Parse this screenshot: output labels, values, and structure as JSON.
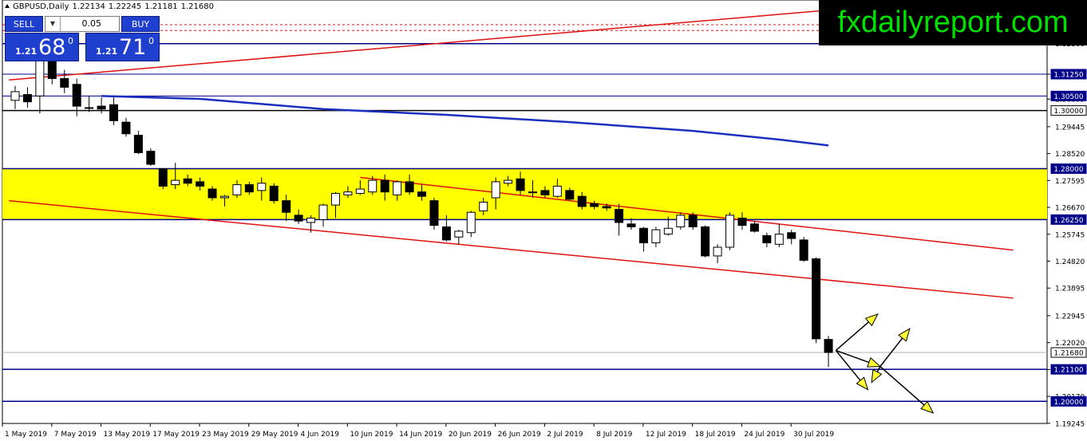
{
  "header": {
    "symbol": "GBPUSD,Daily",
    "open": "1.22134",
    "high": "1.22245",
    "low": "1.21181",
    "close": "1.21680"
  },
  "trade_panel": {
    "sell_label": "SELL",
    "buy_label": "BUY",
    "lot": "0.05",
    "sell_price": {
      "small": "1.21",
      "big": "68",
      "sup": "0"
    },
    "buy_price": {
      "small": "1.21",
      "big": "71",
      "sup": "0"
    }
  },
  "brand": "fxdailyreport.com",
  "colors": {
    "zone": "#ffff00",
    "trendline": "#e01010",
    "ma": "#1a2fbf",
    "level": "#00008b",
    "label_bg": "#00008b",
    "candle_bull": "#ffffff",
    "candle_bear": "#000000",
    "arrow_fill": "#ffff33",
    "brand_bg": "#000000",
    "brand_text": "#00e000"
  },
  "chart_data": {
    "type": "candlestick",
    "ylim": [
      1.1924,
      1.338
    ],
    "price_ticks": [
      "1.32300",
      "1.31250",
      "1.30395",
      "1.29445",
      "1.28520",
      "1.27595",
      "1.26670",
      "1.25745",
      "1.24820",
      "1.23895",
      "1.22945",
      "1.22020",
      "1.21095",
      "1.20170",
      "1.19245"
    ],
    "x_labels": [
      {
        "text": "1 May 2019",
        "i": 0
      },
      {
        "text": "7 May 2019",
        "i": 4
      },
      {
        "text": "13 May 2019",
        "i": 8
      },
      {
        "text": "17 May 2019",
        "i": 12
      },
      {
        "text": "23 May 2019",
        "i": 16
      },
      {
        "text": "29 May 2019",
        "i": 20
      },
      {
        "text": "4 Jun 2019",
        "i": 24
      },
      {
        "text": "10 Jun 2019",
        "i": 28
      },
      {
        "text": "14 Jun 2019",
        "i": 32
      },
      {
        "text": "20 Jun 2019",
        "i": 36
      },
      {
        "text": "26 Jun 2019",
        "i": 40
      },
      {
        "text": "2 Jul 2019",
        "i": 44
      },
      {
        "text": "8 Jul 2019",
        "i": 48
      },
      {
        "text": "12 Jul 2019",
        "i": 52
      },
      {
        "text": "18 Jul 2019",
        "i": 56
      },
      {
        "text": "24 Jul 2019",
        "i": 60
      },
      {
        "text": "30 Jul 2019",
        "i": 64
      }
    ],
    "candles": [
      [
        1.3035,
        1.3085,
        1.3005,
        1.3065
      ],
      [
        1.3055,
        1.308,
        1.301,
        1.303
      ],
      [
        1.305,
        1.319,
        1.299,
        1.318
      ],
      [
        1.3175,
        1.319,
        1.309,
        1.311
      ],
      [
        1.311,
        1.314,
        1.306,
        1.308
      ],
      [
        1.309,
        1.311,
        1.298,
        1.3015
      ],
      [
        1.301,
        1.305,
        1.2995,
        1.301
      ],
      [
        1.3015,
        1.3045,
        1.299,
        1.3005
      ],
      [
        1.302,
        1.3045,
        1.295,
        1.2965
      ],
      [
        1.296,
        1.2975,
        1.291,
        1.292
      ],
      [
        1.2915,
        1.293,
        1.285,
        1.2855
      ],
      [
        1.286,
        1.287,
        1.281,
        1.2815
      ],
      [
        1.28,
        1.28,
        1.273,
        1.274
      ],
      [
        1.2745,
        1.282,
        1.273,
        1.276
      ],
      [
        1.2765,
        1.278,
        1.274,
        1.275
      ],
      [
        1.2755,
        1.277,
        1.2725,
        1.274
      ],
      [
        1.273,
        1.274,
        1.269,
        1.27
      ],
      [
        1.27,
        1.271,
        1.267,
        1.2705
      ],
      [
        1.271,
        1.276,
        1.27,
        1.2745
      ],
      [
        1.2745,
        1.2755,
        1.271,
        1.272
      ],
      [
        1.2725,
        1.277,
        1.269,
        1.275
      ],
      [
        1.274,
        1.275,
        1.268,
        1.269
      ],
      [
        1.269,
        1.271,
        1.262,
        1.265
      ],
      [
        1.264,
        1.266,
        1.261,
        1.262
      ],
      [
        1.2615,
        1.264,
        1.258,
        1.263
      ],
      [
        1.2625,
        1.268,
        1.26,
        1.2675
      ],
      [
        1.2675,
        1.272,
        1.263,
        1.2715
      ],
      [
        1.271,
        1.274,
        1.27,
        1.272
      ],
      [
        1.2715,
        1.276,
        1.271,
        1.273
      ],
      [
        1.272,
        1.2775,
        1.271,
        1.276
      ],
      [
        1.276,
        1.278,
        1.269,
        1.272
      ],
      [
        1.271,
        1.276,
        1.269,
        1.2755
      ],
      [
        1.2755,
        1.278,
        1.271,
        1.272
      ],
      [
        1.272,
        1.2745,
        1.269,
        1.2705
      ],
      [
        1.269,
        1.27,
        1.259,
        1.2605
      ],
      [
        1.26,
        1.264,
        1.255,
        1.2555
      ],
      [
        1.2565,
        1.259,
        1.254,
        1.2585
      ],
      [
        1.258,
        1.2655,
        1.2565,
        1.265
      ],
      [
        1.2655,
        1.27,
        1.264,
        1.2685
      ],
      [
        1.27,
        1.277,
        1.266,
        1.2755
      ],
      [
        1.275,
        1.2775,
        1.274,
        1.276
      ],
      [
        1.2765,
        1.279,
        1.271,
        1.2725
      ],
      [
        1.272,
        1.276,
        1.27,
        1.272
      ],
      [
        1.2725,
        1.274,
        1.27,
        1.271
      ],
      [
        1.2705,
        1.2765,
        1.27,
        1.274
      ],
      [
        1.2725,
        1.2735,
        1.269,
        1.2695
      ],
      [
        1.2705,
        1.272,
        1.266,
        1.267
      ],
      [
        1.268,
        1.269,
        1.266,
        1.267
      ],
      [
        1.267,
        1.268,
        1.2655,
        1.2665
      ],
      [
        1.266,
        1.268,
        1.257,
        1.2615
      ],
      [
        1.261,
        1.263,
        1.259,
        1.26
      ],
      [
        1.2595,
        1.26,
        1.2515,
        1.2545
      ],
      [
        1.2545,
        1.26,
        1.253,
        1.259
      ],
      [
        1.2575,
        1.2635,
        1.257,
        1.2595
      ],
      [
        1.26,
        1.265,
        1.259,
        1.264
      ],
      [
        1.264,
        1.265,
        1.259,
        1.26
      ],
      [
        1.26,
        1.2605,
        1.2495,
        1.25
      ],
      [
        1.25,
        1.254,
        1.2475,
        1.253
      ],
      [
        1.253,
        1.265,
        1.252,
        1.264
      ],
      [
        1.263,
        1.265,
        1.259,
        1.2605
      ],
      [
        1.261,
        1.262,
        1.258,
        1.2585
      ],
      [
        1.257,
        1.258,
        1.253,
        1.2545
      ],
      [
        1.254,
        1.261,
        1.253,
        1.2575
      ],
      [
        1.258,
        1.259,
        1.254,
        1.256
      ],
      [
        1.2555,
        1.2565,
        1.248,
        1.2485
      ],
      [
        1.249,
        1.2495,
        1.22,
        1.2215
      ],
      [
        1.2213,
        1.2225,
        1.2118,
        1.2168
      ]
    ],
    "levels": [
      {
        "price": 1.323,
        "label": "",
        "color": "#00008b",
        "width": 1.5
      },
      {
        "price": 1.3125,
        "label": "1.31250",
        "color": "#00008b",
        "width": 1
      },
      {
        "price": 1.305,
        "label": "1.30500",
        "color": "#00008b",
        "width": 1
      },
      {
        "price": 1.3,
        "label": "1.30000",
        "color": "#000000",
        "width": 1.5
      },
      {
        "price": 1.28,
        "label": "1.28000",
        "color": "#00008b",
        "width": 1.5
      },
      {
        "price": 1.2625,
        "label": "1.26250",
        "color": "#00008b",
        "width": 1.5
      },
      {
        "price": 1.211,
        "label": "1.21100",
        "color": "#00008b",
        "width": 1.5
      },
      {
        "price": 1.2,
        "label": "1.20000",
        "color": "#00008b",
        "width": 1.5
      }
    ],
    "current_price": {
      "price": 1.2168,
      "label": "1.21680"
    },
    "zone": [
      1.2625,
      1.28
    ],
    "trendlines": [
      {
        "from": [
          -0.5,
          1.3105
        ],
        "to": [
          84,
          1.341
        ]
      },
      {
        "from": [
          -0.5,
          1.269
        ],
        "to": [
          81,
          1.2355
        ]
      },
      {
        "from": [
          28,
          1.277
        ],
        "to": [
          81,
          1.252
        ]
      }
    ],
    "ma": [
      [
        7,
        1.305
      ],
      [
        15,
        1.304
      ],
      [
        25,
        1.3005
      ],
      [
        35,
        1.2985
      ],
      [
        45,
        1.296
      ],
      [
        55,
        1.293
      ],
      [
        62,
        1.29
      ],
      [
        66,
        1.288
      ]
    ],
    "arrows": [
      {
        "from": [
          66.6,
          1.2175
        ],
        "to": [
          70,
          1.23
        ]
      },
      {
        "from": [
          66.6,
          1.2175
        ],
        "to": [
          70.2,
          1.212
        ]
      },
      {
        "from": [
          70.2,
          1.212
        ],
        "to": [
          72.6,
          1.225
        ]
      },
      {
        "from": [
          70.2,
          1.212
        ],
        "to": [
          69.5,
          1.2065
        ]
      },
      {
        "from": [
          66.6,
          1.2175
        ],
        "to": [
          69.2,
          1.204
        ]
      },
      {
        "from": [
          70.2,
          1.212
        ],
        "to": [
          74.5,
          1.196
        ]
      }
    ]
  }
}
